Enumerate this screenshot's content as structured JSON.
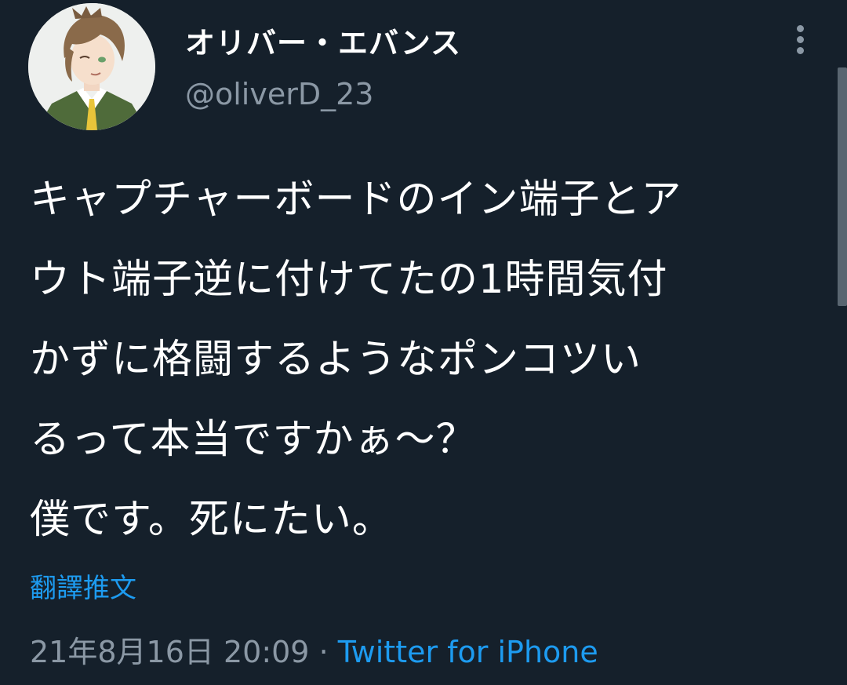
{
  "author": {
    "display_name": "オリバー・エバンス",
    "handle": "@oliverD_23"
  },
  "tweet": {
    "text_lines": [
      "キャプチャーボードのイン端子とア",
      "ウト端子逆に付けてたの1時間気付",
      "かずに格闘するようなポンコツい",
      "るって本当ですかぁ〜？",
      "僕です。死にたい。"
    ],
    "translate_label": "翻譯推文",
    "timestamp": "21年8月16日 20:09",
    "separator": " · ",
    "source": "Twitter for iPhone"
  },
  "icons": {
    "more": "more-vertical-icon",
    "avatar": "avatar-illustration"
  },
  "colors": {
    "background": "#15202b",
    "text": "#ffffff",
    "secondary_text": "#8b98a5",
    "accent": "#1d9bf0"
  }
}
